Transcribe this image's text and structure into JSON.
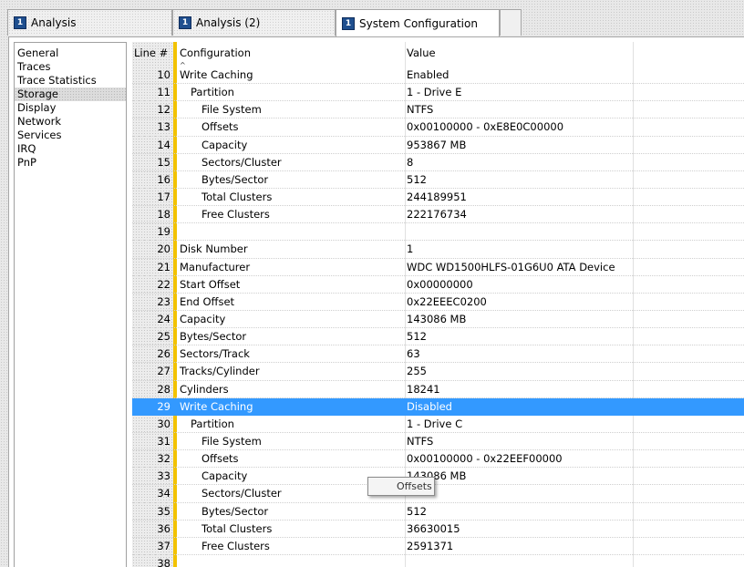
{
  "tabs": [
    {
      "num": "1",
      "label": "Analysis"
    },
    {
      "num": "1",
      "label": "Analysis (2)"
    },
    {
      "num": "1",
      "label": "System Configuration"
    }
  ],
  "nav": {
    "items": [
      "General",
      "Traces",
      "Trace Statistics",
      "Storage",
      "Display",
      "Network",
      "Services",
      "IRQ",
      "PnP"
    ],
    "selected": "Storage"
  },
  "grid": {
    "headers": {
      "line": "Line #",
      "configuration": "Configuration",
      "value": "Value"
    },
    "rows": [
      {
        "line": "10",
        "configuration": "Write Caching",
        "value": "Enabled",
        "indent": 0
      },
      {
        "line": "11",
        "configuration": "Partition",
        "value": "1 - Drive E",
        "indent": 1
      },
      {
        "line": "12",
        "configuration": "File System",
        "value": "NTFS",
        "indent": 2
      },
      {
        "line": "13",
        "configuration": "Offsets",
        "value": "0x00100000 - 0xE8E0C00000",
        "indent": 2
      },
      {
        "line": "14",
        "configuration": "Capacity",
        "value": "953867 MB",
        "indent": 2
      },
      {
        "line": "15",
        "configuration": "Sectors/Cluster",
        "value": "8",
        "indent": 2
      },
      {
        "line": "16",
        "configuration": "Bytes/Sector",
        "value": "512",
        "indent": 2
      },
      {
        "line": "17",
        "configuration": "Total Clusters",
        "value": "244189951",
        "indent": 2
      },
      {
        "line": "18",
        "configuration": "Free Clusters",
        "value": "222176734",
        "indent": 2
      },
      {
        "line": "19",
        "configuration": "",
        "value": "",
        "indent": 0
      },
      {
        "line": "20",
        "configuration": "Disk Number",
        "value": "1",
        "indent": 0
      },
      {
        "line": "21",
        "configuration": "Manufacturer",
        "value": "WDC WD1500HLFS-01G6U0 ATA Device",
        "indent": 0
      },
      {
        "line": "22",
        "configuration": "Start Offset",
        "value": "0x00000000",
        "indent": 0
      },
      {
        "line": "23",
        "configuration": "End Offset",
        "value": "0x22EEEC0200",
        "indent": 0
      },
      {
        "line": "24",
        "configuration": "Capacity",
        "value": "143086 MB",
        "indent": 0
      },
      {
        "line": "25",
        "configuration": "Bytes/Sector",
        "value": "512",
        "indent": 0
      },
      {
        "line": "26",
        "configuration": "Sectors/Track",
        "value": "63",
        "indent": 0
      },
      {
        "line": "27",
        "configuration": "Tracks/Cylinder",
        "value": "255",
        "indent": 0
      },
      {
        "line": "28",
        "configuration": "Cylinders",
        "value": "18241",
        "indent": 0
      },
      {
        "line": "29",
        "configuration": "Write Caching",
        "value": "Disabled",
        "indent": 0,
        "selected": true
      },
      {
        "line": "30",
        "configuration": "Partition",
        "value": "1 - Drive C",
        "indent": 1
      },
      {
        "line": "31",
        "configuration": "File System",
        "value": "NTFS",
        "indent": 2
      },
      {
        "line": "32",
        "configuration": "Offsets",
        "value": "0x00100000 - 0x22EEF00000",
        "indent": 2
      },
      {
        "line": "33",
        "configuration": "Capacity",
        "value": "143086 MB",
        "indent": 2
      },
      {
        "line": "34",
        "configuration": "Sectors/Cluster",
        "value": "",
        "indent": 2
      },
      {
        "line": "35",
        "configuration": "Bytes/Sector",
        "value": "512",
        "indent": 2
      },
      {
        "line": "36",
        "configuration": "Total Clusters",
        "value": "36630015",
        "indent": 2
      },
      {
        "line": "37",
        "configuration": "Free Clusters",
        "value": "2591371",
        "indent": 2
      },
      {
        "line": "38",
        "configuration": "",
        "value": "",
        "indent": 0
      }
    ]
  },
  "tooltip": {
    "text": "Offsets"
  },
  "colors": {
    "accent_bar": "#f2c200",
    "selection": "#3399ff",
    "tab_badge": "#1f4f8f"
  }
}
